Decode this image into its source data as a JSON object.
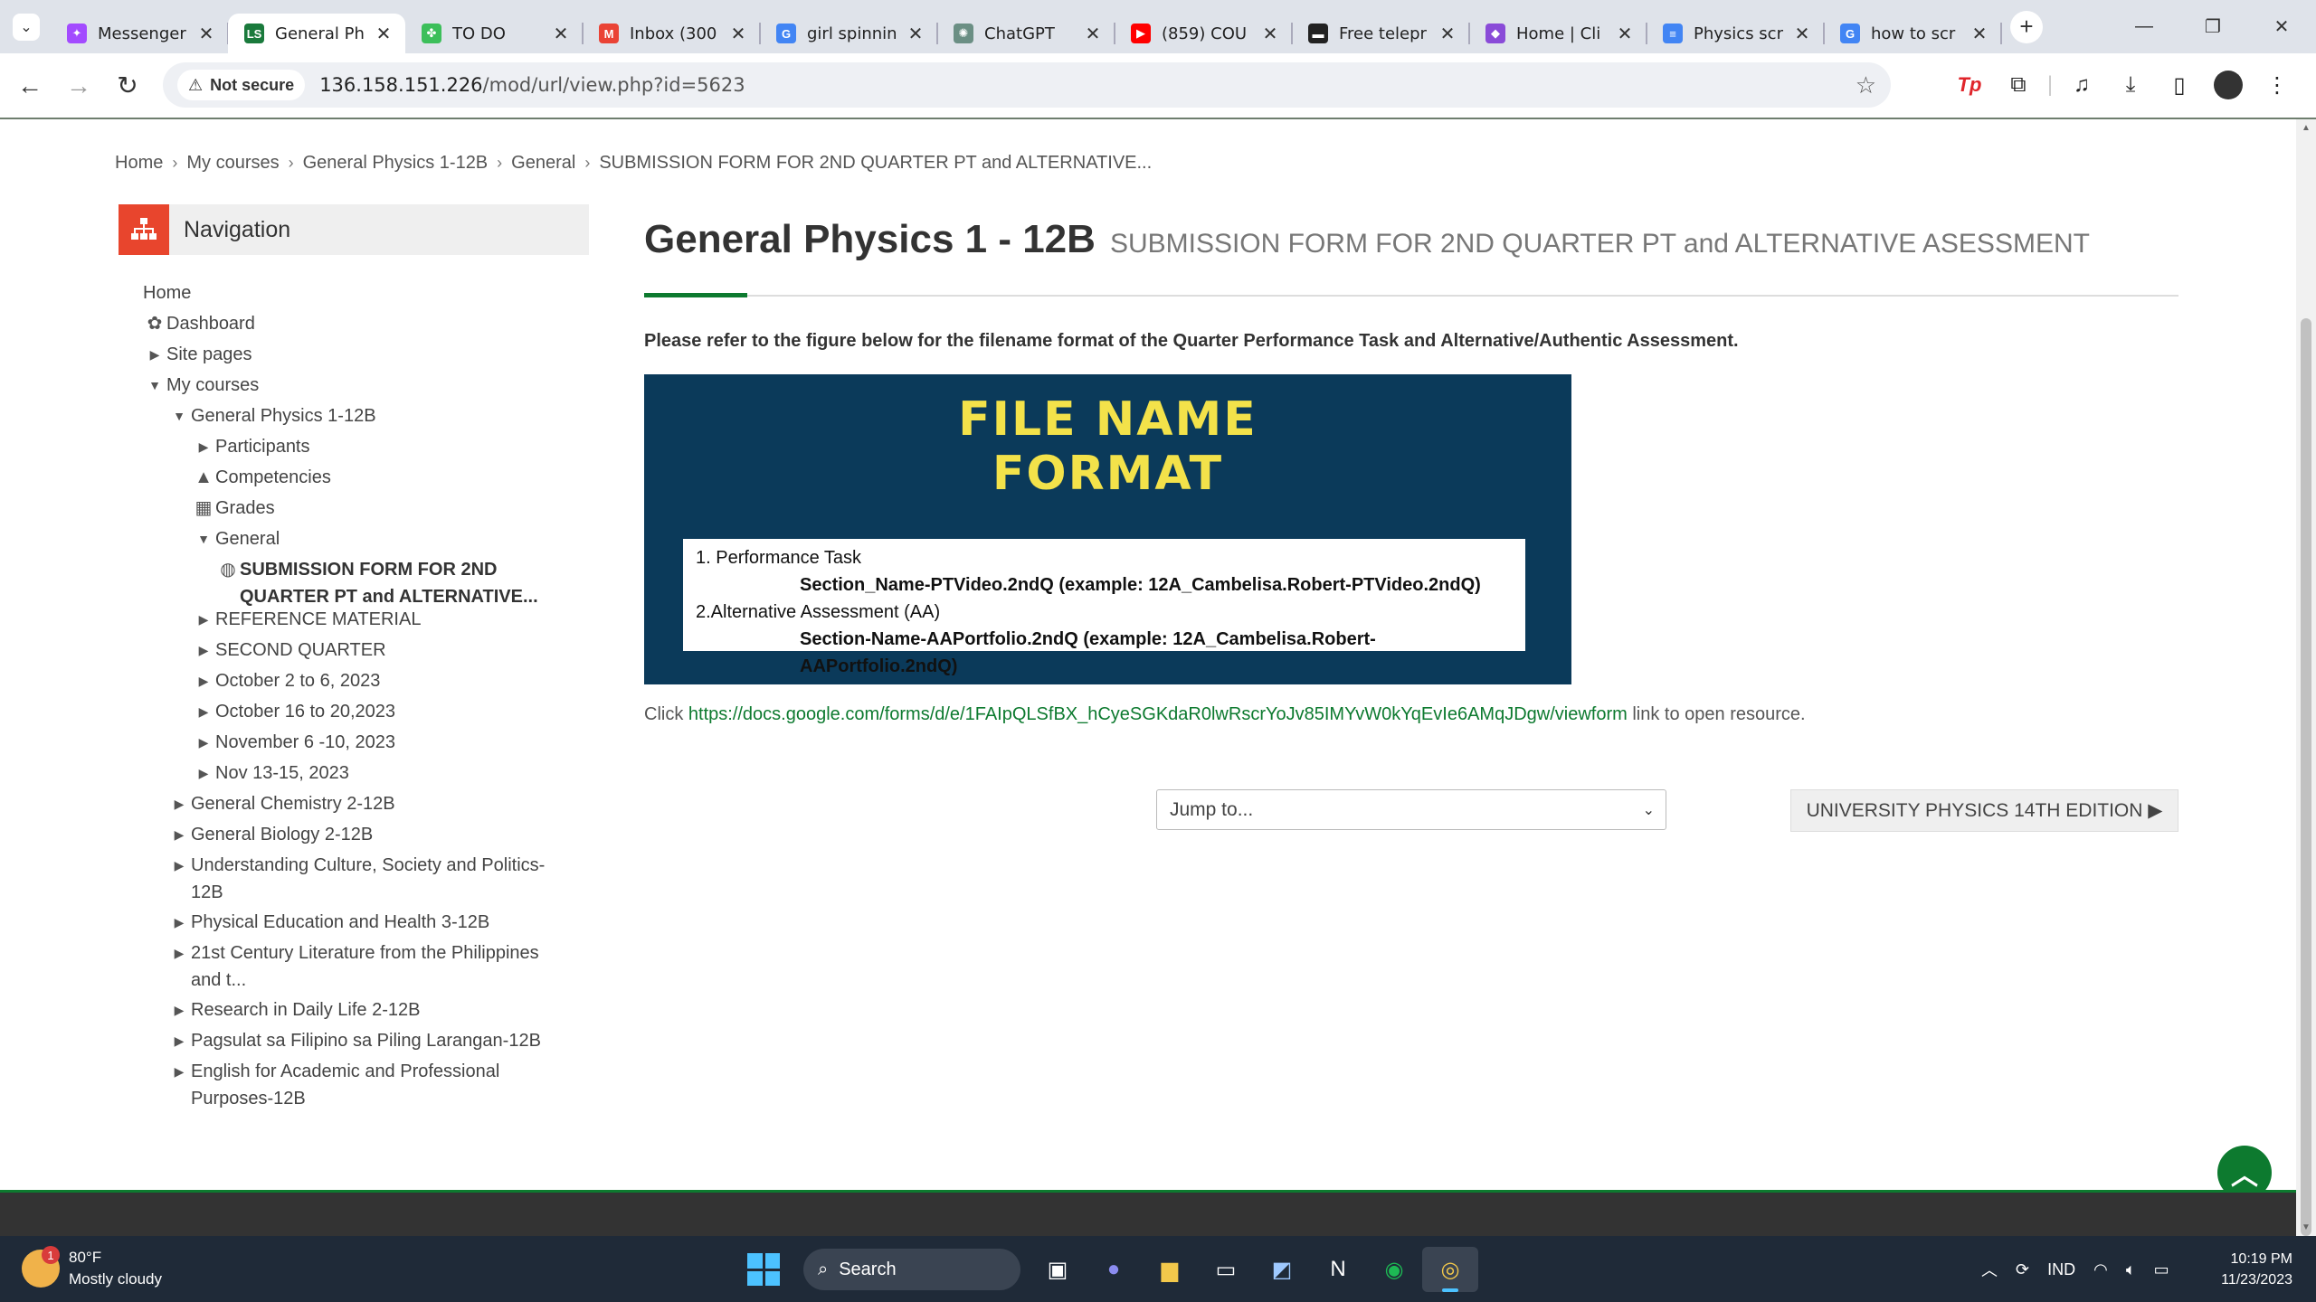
{
  "browser": {
    "tabs": [
      {
        "label": "Messenger",
        "color": "#a34bff",
        "glyph": "✦"
      },
      {
        "label": "General Ph",
        "color": "#1a7a3c",
        "glyph": "LS",
        "active": true
      },
      {
        "label": "TO DO",
        "color": "#3cbf5a",
        "glyph": "✤"
      },
      {
        "label": "Inbox (300",
        "color": "#ea4335",
        "glyph": "M"
      },
      {
        "label": "girl spinnin",
        "color": "#4285f4",
        "glyph": "G"
      },
      {
        "label": "ChatGPT",
        "color": "#6b8f84",
        "glyph": "✺"
      },
      {
        "label": "(859) COU",
        "color": "#ff0000",
        "glyph": "▶"
      },
      {
        "label": "Free telepr",
        "color": "#222222",
        "glyph": "▬"
      },
      {
        "label": "Home | Cli",
        "color": "#8a4bd8",
        "glyph": "◆"
      },
      {
        "label": "Physics scr",
        "color": "#4285f4",
        "glyph": "≡"
      },
      {
        "label": "how to scr",
        "color": "#4285f4",
        "glyph": "G"
      }
    ],
    "security_label": "Not secure",
    "url_host": "136.158.151.226",
    "url_path": "/mod/url/view.php?id=5623"
  },
  "breadcrumb": [
    "Home",
    "My courses",
    "General Physics 1-12B",
    "General",
    "SUBMISSION FORM FOR 2ND QUARTER PT and ALTERNATIVE..."
  ],
  "navigation": {
    "title": "Navigation",
    "items": [
      {
        "label": "Home",
        "level": 0,
        "arrow": "",
        "icon": ""
      },
      {
        "label": "Dashboard",
        "level": 0,
        "arrow": "",
        "icon": "dashboard"
      },
      {
        "label": "Site pages",
        "level": 0,
        "arrow": "right",
        "icon": ""
      },
      {
        "label": "My courses",
        "level": 0,
        "arrow": "down",
        "icon": ""
      },
      {
        "label": "General Physics 1-12B",
        "level": 1,
        "arrow": "down",
        "icon": ""
      },
      {
        "label": "Participants",
        "level": 2,
        "arrow": "right",
        "icon": ""
      },
      {
        "label": "Competencies",
        "level": 2,
        "arrow": "",
        "icon": "competencies"
      },
      {
        "label": "Grades",
        "level": 2,
        "arrow": "",
        "icon": "grades"
      },
      {
        "label": "General",
        "level": 2,
        "arrow": "down",
        "icon": ""
      },
      {
        "label": "SUBMISSION FORM FOR 2ND QUARTER PT and ALTERNATIVE...",
        "level": 3,
        "arrow": "",
        "icon": "globe",
        "bold": true
      },
      {
        "label": "REFERENCE MATERIAL",
        "level": 2,
        "arrow": "right",
        "icon": ""
      },
      {
        "label": "SECOND QUARTER",
        "level": 2,
        "arrow": "right",
        "icon": ""
      },
      {
        "label": "October 2 to 6, 2023",
        "level": 2,
        "arrow": "right",
        "icon": ""
      },
      {
        "label": "October 16 to 20,2023",
        "level": 2,
        "arrow": "right",
        "icon": ""
      },
      {
        "label": "November 6 -10, 2023",
        "level": 2,
        "arrow": "right",
        "icon": ""
      },
      {
        "label": "Nov 13-15, 2023",
        "level": 2,
        "arrow": "right",
        "icon": ""
      },
      {
        "label": "General Chemistry 2-12B",
        "level": 1,
        "arrow": "right",
        "icon": ""
      },
      {
        "label": "General Biology 2-12B",
        "level": 1,
        "arrow": "right",
        "icon": ""
      },
      {
        "label": "Understanding Culture, Society and Politics-12B",
        "level": 1,
        "arrow": "right",
        "icon": ""
      },
      {
        "label": "Physical Education and Health 3-12B",
        "level": 1,
        "arrow": "right",
        "icon": ""
      },
      {
        "label": "21st Century Literature from the Philippines and t...",
        "level": 1,
        "arrow": "right",
        "icon": ""
      },
      {
        "label": "Research in Daily Life 2-12B",
        "level": 1,
        "arrow": "right",
        "icon": ""
      },
      {
        "label": "Pagsulat sa Filipino sa Piling Larangan-12B",
        "level": 1,
        "arrow": "right",
        "icon": ""
      },
      {
        "label": "English for Academic and Professional Purposes-12B",
        "level": 1,
        "arrow": "right",
        "icon": ""
      }
    ]
  },
  "main": {
    "course_title": "General Physics 1 - 12B",
    "page_subtitle": "SUBMISSION FORM FOR 2ND QUARTER PT and ALTERNATIVE ASESSMENT",
    "intro": "Please refer to the figure below for the filename format of the Quarter Performance Task and Alternative/Authentic Assessment.",
    "figure": {
      "title_line1": "FILE NAME",
      "title_line2": "FORMAT",
      "item1": "1.  Performance Task",
      "item1_format": "Section_Name-PTVideo.2ndQ (example: 12A_Cambelisa.Robert-PTVideo.2ndQ)",
      "item2": "2.Alternative Assessment (AA)",
      "item2_format": "Section-Name-AAPortfolio.2ndQ (example: 12A_Cambelisa.Robert-AAPortfolio.2ndQ)"
    },
    "link_prefix": "Click",
    "link_url": "https://docs.google.com/forms/d/e/1FAIpQLSfBX_hCyeSGKdaR0lwRscrYoJv85IMYvW0kYqEvIe6AMqJDgw/viewform",
    "link_suffix": "link to open resource.",
    "jump_placeholder": "Jump to...",
    "next_button": "UNIVERSITY PHYSICS 14TH EDITION ▶"
  },
  "taskbar": {
    "weather_temp": "80°F",
    "weather_desc": "Mostly cloudy",
    "weather_badge": "1",
    "search_label": "Search",
    "language": "IND",
    "time": "10:19 PM",
    "date": "11/23/2023"
  },
  "colors": {
    "accent": "#0d7a2f",
    "nav_icon": "#e8452d",
    "figure_bg": "#0b3a5a",
    "figure_title": "#f3e24a"
  }
}
